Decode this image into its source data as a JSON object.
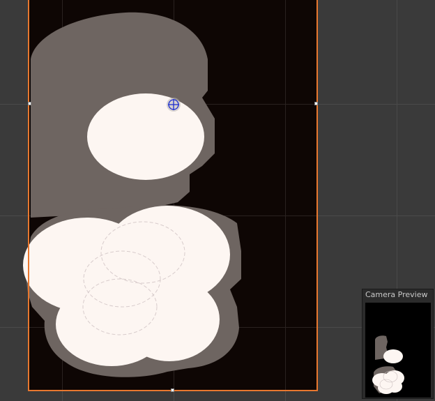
{
  "scene_view": {
    "background_color": "#3a3a3a",
    "canvas_color": "#0e0604",
    "selection_color": "#e8772e",
    "shadow_color": "#6e6561",
    "highlight_color": "#fdf6f2",
    "pivot_color": "#1e2fd0",
    "pivot_icon": "move-pivot-icon"
  },
  "camera_preview": {
    "title": "Camera Preview"
  }
}
